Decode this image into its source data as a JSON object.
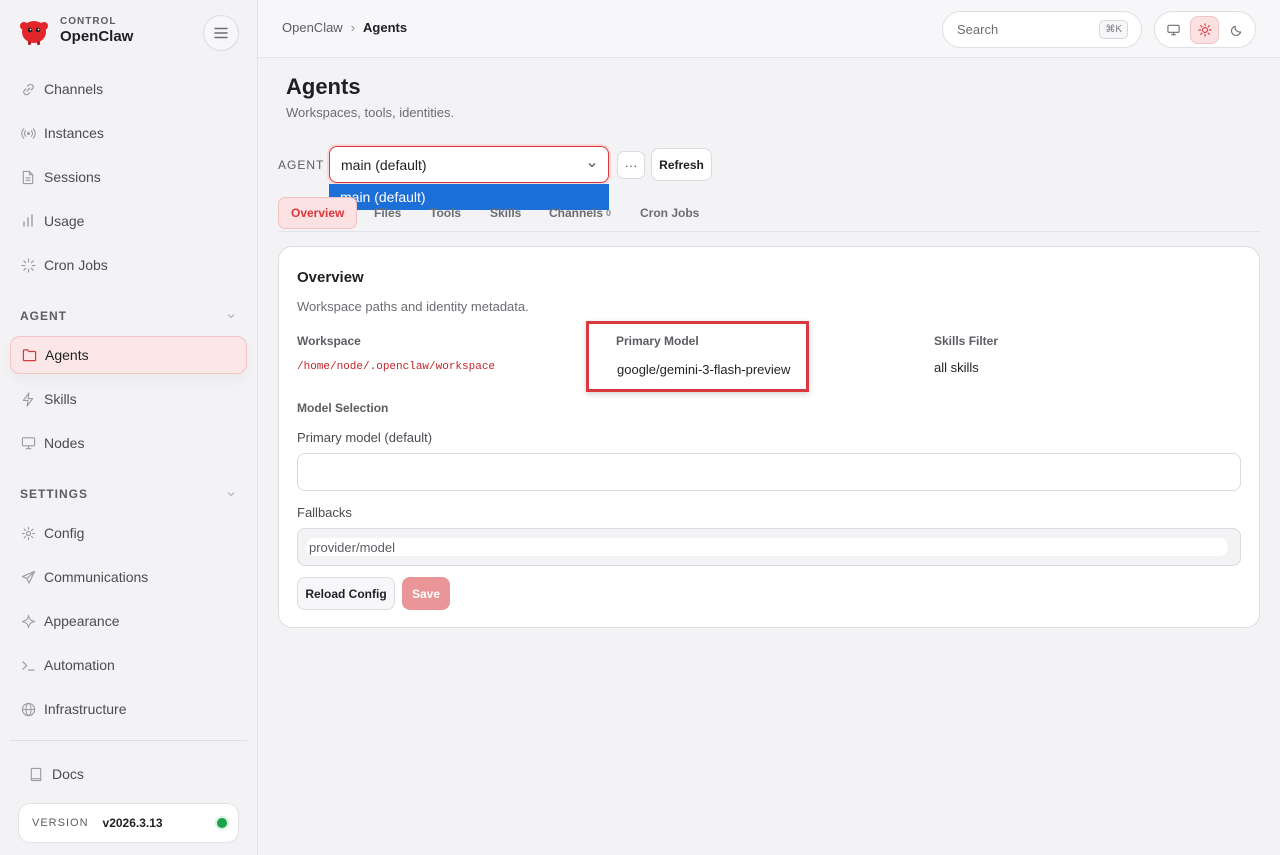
{
  "brand": {
    "small": "CONTROL",
    "name": "OpenClaw"
  },
  "sidebar": {
    "items_top": [
      {
        "label": "Channels",
        "icon": "link-icon"
      },
      {
        "label": "Instances",
        "icon": "radio-icon"
      },
      {
        "label": "Sessions",
        "icon": "file-icon"
      },
      {
        "label": "Usage",
        "icon": "bar-chart-icon"
      },
      {
        "label": "Cron Jobs",
        "icon": "loader-icon"
      }
    ],
    "agent_section": "AGENT",
    "agent_items": [
      {
        "label": "Agents",
        "icon": "folder-icon",
        "active": true
      },
      {
        "label": "Skills",
        "icon": "zap-icon"
      },
      {
        "label": "Nodes",
        "icon": "monitor-icon"
      }
    ],
    "settings_section": "SETTINGS",
    "settings_items": [
      {
        "label": "Config",
        "icon": "gear-icon"
      },
      {
        "label": "Communications",
        "icon": "send-icon"
      },
      {
        "label": "Appearance",
        "icon": "sparkle-icon"
      },
      {
        "label": "Automation",
        "icon": "terminal-icon"
      },
      {
        "label": "Infrastructure",
        "icon": "globe-icon"
      }
    ],
    "docs": "Docs",
    "version_label": "VERSION",
    "version_value": "v2026.3.13",
    "status_color": "#1aa34a"
  },
  "topbar": {
    "breadcrumb_root": "OpenClaw",
    "breadcrumb_sep": "›",
    "breadcrumb_current": "Agents",
    "search_placeholder": "Search",
    "search_shortcut": "⌘K",
    "theme_active": "light"
  },
  "page": {
    "title": "Agents",
    "subtitle": "Workspaces, tools, identities."
  },
  "agent_bar": {
    "label": "AGENT",
    "selected": "main (default)",
    "options": [
      "main (default)"
    ],
    "more_label": "···",
    "refresh_label": "Refresh"
  },
  "tabs": [
    {
      "label": "Overview",
      "active": true
    },
    {
      "label": "Files"
    },
    {
      "label": "Tools"
    },
    {
      "label": "Skills"
    },
    {
      "label": "Channels",
      "badge": "0"
    },
    {
      "label": "Cron Jobs"
    }
  ],
  "overview": {
    "title": "Overview",
    "subtitle": "Workspace paths and identity metadata.",
    "workspace_label": "Workspace",
    "workspace_value": "/home/node/.openclaw/workspace",
    "primary_model_label": "Primary Model",
    "primary_model_value": "google/gemini-3-flash-preview",
    "skills_filter_label": "Skills Filter",
    "skills_filter_value": "all skills",
    "model_selection_label": "Model Selection",
    "primary_model_default_label": "Primary model (default)",
    "primary_model_input": "",
    "fallbacks_label": "Fallbacks",
    "fallbacks_placeholder": "provider/model",
    "reload_label": "Reload Config",
    "save_label": "Save"
  },
  "colors": {
    "accent": "#d9383e",
    "dropdown_highlight": "#1d6fd8"
  }
}
